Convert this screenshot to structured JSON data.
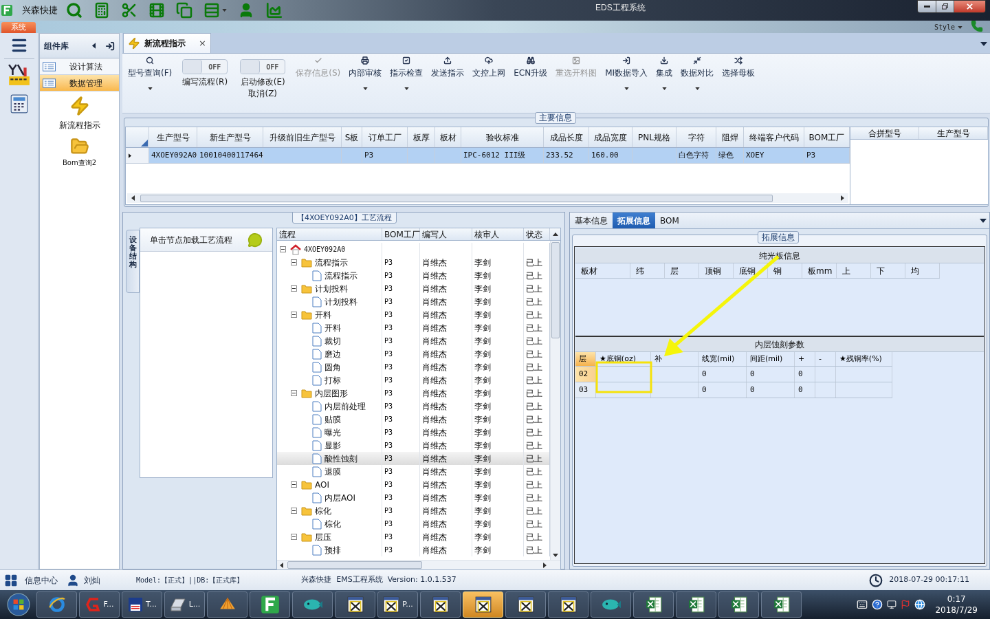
{
  "title_bar": {
    "app_name": "兴森快捷",
    "title": "EDS工程系统"
  },
  "menu_tab": "系统",
  "style_menu": "Style",
  "component_library": {
    "title": "组件库",
    "items": [
      {
        "label": "设计算法",
        "selected": false
      },
      {
        "label": "数据管理",
        "selected": true
      }
    ],
    "tools": [
      "新流程指示",
      "Bom查询2"
    ]
  },
  "document_tab": {
    "title": "新流程指示",
    "close": "×"
  },
  "toolbar": [
    {
      "kind": "button",
      "lines": [
        "型号查询(F)"
      ],
      "dropdown": true,
      "disabled": false
    },
    {
      "kind": "toggle",
      "switch_label": "OFF",
      "on": false,
      "lines": [
        "编写流程(R)"
      ]
    },
    {
      "kind": "toggle",
      "switch_label": "OFF",
      "on": false,
      "lines": [
        "启动修改(E)",
        "取消(Z)"
      ]
    },
    {
      "kind": "button",
      "lines": [
        "保存信息(S)"
      ],
      "dropdown": false,
      "disabled": true
    },
    {
      "kind": "button",
      "lines": [
        "内部审核"
      ],
      "dropdown": true,
      "disabled": false
    },
    {
      "kind": "button",
      "lines": [
        "指示检查"
      ],
      "dropdown": true,
      "disabled": false
    },
    {
      "kind": "button",
      "lines": [
        "发送指示"
      ],
      "dropdown": false,
      "disabled": false
    },
    {
      "kind": "button",
      "lines": [
        "文控上网"
      ],
      "dropdown": false,
      "disabled": false
    },
    {
      "kind": "button",
      "lines": [
        "ECN升级"
      ],
      "dropdown": false,
      "disabled": false
    },
    {
      "kind": "button",
      "lines": [
        "重选开料图"
      ],
      "dropdown": false,
      "disabled": true
    },
    {
      "kind": "button",
      "lines": [
        "MI数据导入"
      ],
      "dropdown": true,
      "disabled": false
    },
    {
      "kind": "button",
      "lines": [
        "集成"
      ],
      "dropdown": true,
      "disabled": false
    },
    {
      "kind": "button",
      "lines": [
        "数据对比"
      ],
      "dropdown": true,
      "disabled": false
    },
    {
      "kind": "button",
      "lines": [
        "选择母板"
      ],
      "dropdown": false,
      "disabled": false
    }
  ],
  "main_info": {
    "title": "主要信息",
    "columns": [
      "生产型号",
      "新生产型号",
      "升级前旧生产型号",
      "S板",
      "订单工厂",
      "板厚",
      "板材",
      "验收标准",
      "成品长度",
      "成品宽度",
      "PNL规格",
      "字符",
      "阻焊",
      "终端客户代码",
      "BOM工厂"
    ],
    "rows": [
      {
        "selected": true,
        "cells": [
          "4XOEY092A0",
          "10010400117464",
          null,
          null,
          "P3",
          null,
          null,
          "IPC-6012 III级",
          "233.52",
          "160.00",
          null,
          "白色字符",
          "绿色",
          "XOEY",
          "P3"
        ]
      }
    ],
    "side_columns": [
      "合拼型号",
      "生产型号"
    ]
  },
  "process_panel": {
    "title": "【4XOEY092A0】工艺流程",
    "side_tab": "设备结构",
    "hint": "单击节点加载工艺流程",
    "columns": [
      "流程",
      "BOM工厂",
      "编写人",
      "核审人",
      "状态"
    ],
    "tree": [
      {
        "kind": "root",
        "name": "4XOEY092A0",
        "expanded": true,
        "selected": false,
        "children": [
          {
            "kind": "folder",
            "name": "流程指示",
            "bom": "P3",
            "writer": "肖维杰",
            "reviewer": "李剑",
            "status": "已上",
            "expanded": true,
            "selected": false,
            "children": [
              {
                "kind": "step",
                "name": "流程指示",
                "bom": "P3",
                "writer": "肖维杰",
                "reviewer": "李剑",
                "status": "已上",
                "selected": false
              }
            ]
          },
          {
            "kind": "folder",
            "name": "计划投料",
            "bom": "P3",
            "writer": "肖维杰",
            "reviewer": "李剑",
            "status": "已上",
            "expanded": true,
            "selected": false,
            "children": [
              {
                "kind": "step",
                "name": "计划投料",
                "bom": "P3",
                "writer": "肖维杰",
                "reviewer": "李剑",
                "status": "已上",
                "selected": false
              }
            ]
          },
          {
            "kind": "folder",
            "name": "开料",
            "bom": "P3",
            "writer": "肖维杰",
            "reviewer": "李剑",
            "status": "已上",
            "expanded": true,
            "selected": false,
            "children": [
              {
                "kind": "step",
                "name": "开料",
                "bom": "P3",
                "writer": "肖维杰",
                "reviewer": "李剑",
                "status": "已上",
                "selected": false
              },
              {
                "kind": "step",
                "name": "裁切",
                "bom": "P3",
                "writer": "肖维杰",
                "reviewer": "李剑",
                "status": "已上",
                "selected": false
              },
              {
                "kind": "step",
                "name": "磨边",
                "bom": "P3",
                "writer": "肖维杰",
                "reviewer": "李剑",
                "status": "已上",
                "selected": false
              },
              {
                "kind": "step",
                "name": "圆角",
                "bom": "P3",
                "writer": "肖维杰",
                "reviewer": "李剑",
                "status": "已上",
                "selected": false
              },
              {
                "kind": "step",
                "name": "打标",
                "bom": "P3",
                "writer": "肖维杰",
                "reviewer": "李剑",
                "status": "已上",
                "selected": false
              }
            ]
          },
          {
            "kind": "folder",
            "name": "内层图形",
            "bom": "P3",
            "writer": "肖维杰",
            "reviewer": "李剑",
            "status": "已上",
            "expanded": true,
            "selected": false,
            "children": [
              {
                "kind": "step",
                "name": "内层前处理",
                "bom": "P3",
                "writer": "肖维杰",
                "reviewer": "李剑",
                "status": "已上",
                "selected": false
              },
              {
                "kind": "step",
                "name": "贴膜",
                "bom": "P3",
                "writer": "肖维杰",
                "reviewer": "李剑",
                "status": "已上",
                "selected": false
              },
              {
                "kind": "step",
                "name": "曝光",
                "bom": "P3",
                "writer": "肖维杰",
                "reviewer": "李剑",
                "status": "已上",
                "selected": false
              },
              {
                "kind": "step",
                "name": "显影",
                "bom": "P3",
                "writer": "肖维杰",
                "reviewer": "李剑",
                "status": "已上",
                "selected": false
              },
              {
                "kind": "step",
                "name": "酸性蚀刻",
                "bom": "P3",
                "writer": "肖维杰",
                "reviewer": "李剑",
                "status": "已上",
                "selected": true
              },
              {
                "kind": "step",
                "name": "退膜",
                "bom": "P3",
                "writer": "肖维杰",
                "reviewer": "李剑",
                "status": "已上",
                "selected": false
              }
            ]
          },
          {
            "kind": "folder",
            "name": "AOI",
            "bom": "P3",
            "writer": "肖维杰",
            "reviewer": "李剑",
            "status": "已上",
            "expanded": true,
            "selected": false,
            "children": [
              {
                "kind": "step",
                "name": "内层AOI",
                "bom": "P3",
                "writer": "肖维杰",
                "reviewer": "李剑",
                "status": "已上",
                "selected": false
              }
            ]
          },
          {
            "kind": "folder",
            "name": "棕化",
            "bom": "P3",
            "writer": "肖维杰",
            "reviewer": "李剑",
            "status": "已上",
            "expanded": true,
            "selected": false,
            "children": [
              {
                "kind": "step",
                "name": "棕化",
                "bom": "P3",
                "writer": "肖维杰",
                "reviewer": "李剑",
                "status": "已上",
                "selected": false
              }
            ]
          },
          {
            "kind": "folder",
            "name": "层压",
            "bom": "P3",
            "writer": "肖维杰",
            "reviewer": "李剑",
            "status": "已上",
            "expanded": true,
            "selected": false,
            "children": [
              {
                "kind": "step",
                "name": "预排",
                "bom": "P3",
                "writer": "肖维杰",
                "reviewer": "李剑",
                "status": "已上",
                "selected": false
              }
            ]
          }
        ]
      }
    ]
  },
  "detail_panel": {
    "tabs": [
      {
        "label": "基本信息",
        "selected": false
      },
      {
        "label": "拓展信息",
        "selected": true
      },
      {
        "label": "BOM",
        "selected": false
      }
    ],
    "group_title": "拓展信息",
    "board_info": {
      "title": "纯光板信息",
      "columns": [
        "板材",
        "纬",
        "层",
        "顶铜",
        "底铜",
        "铜",
        "板mm",
        "上",
        "下",
        "均"
      ]
    },
    "etching": {
      "title": "内层蚀刻参数",
      "columns": [
        "层",
        "★底铜(oz)",
        "补",
        "线宽(mil)",
        "间距(mil)",
        "+",
        "-",
        "★残铜率(%)"
      ],
      "rows": [
        {
          "selected": true,
          "cells": [
            "02",
            null,
            null,
            "0",
            "0",
            "0",
            null,
            null
          ]
        },
        {
          "selected": false,
          "cells": [
            "03",
            null,
            null,
            "0",
            "0",
            "0",
            null,
            null
          ]
        }
      ]
    }
  },
  "status_bar": {
    "info_center": "信息中心",
    "user": "刘灿",
    "model": "Model:【正式】||DB:【正式库】",
    "product": "兴森快捷  EMS工程系统  Version: 1.0.1.537",
    "datetime": "2018-07-29 00:17:11"
  },
  "taskbar": {
    "items": [
      {
        "kind": "browser",
        "selected": false
      },
      {
        "kind": "red-app",
        "label": "F...",
        "selected": false
      },
      {
        "kind": "disk",
        "label": "T...",
        "selected": false
      },
      {
        "kind": "scanner",
        "label": "L...",
        "selected": false
      },
      {
        "kind": "shell",
        "selected": false
      },
      {
        "kind": "f-app",
        "selected": false
      },
      {
        "kind": "fish",
        "selected": false
      },
      {
        "kind": "window",
        "selected": false
      },
      {
        "kind": "window",
        "label": "P...",
        "selected": false
      },
      {
        "kind": "window",
        "selected": false
      },
      {
        "kind": "window",
        "selected": true
      },
      {
        "kind": "window",
        "selected": false
      },
      {
        "kind": "window",
        "selected": false
      },
      {
        "kind": "fish",
        "selected": false
      },
      {
        "kind": "sheet",
        "selected": false
      },
      {
        "kind": "sheet",
        "selected": false
      },
      {
        "kind": "sheet",
        "selected": false
      },
      {
        "kind": "sheet",
        "selected": false
      }
    ],
    "time": "0:17",
    "date": "2018/7/29"
  }
}
